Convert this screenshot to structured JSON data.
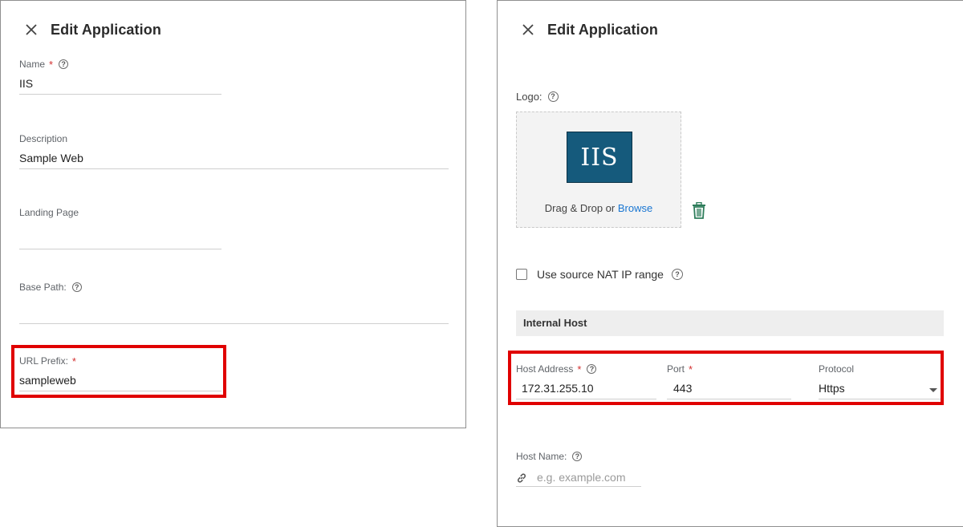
{
  "left": {
    "title": "Edit Application",
    "name": {
      "label": "Name",
      "required": "*",
      "help": "?",
      "value": "IIS"
    },
    "description": {
      "label": "Description",
      "value": "Sample Web"
    },
    "landing_page": {
      "label": "Landing Page",
      "value": ""
    },
    "base_path": {
      "label": "Base Path:",
      "help": "?",
      "value": ""
    },
    "url_prefix": {
      "label": "URL Prefix:",
      "required": "*",
      "value": "sampleweb"
    }
  },
  "right": {
    "title": "Edit Application",
    "logo": {
      "label": "Logo:",
      "help": "?",
      "image_text": "IIS",
      "drop_text": "Drag & Drop or ",
      "browse_label": "Browse"
    },
    "nat": {
      "label": "Use source NAT IP range",
      "help": "?",
      "checked": false
    },
    "section_title": "Internal Host",
    "host_address": {
      "label": "Host Address",
      "required": "*",
      "help": "?",
      "value": "172.31.255.10"
    },
    "port": {
      "label": "Port",
      "required": "*",
      "value": "443"
    },
    "protocol": {
      "label": "Protocol",
      "value": "Https"
    },
    "host_name": {
      "label": "Host Name:",
      "help": "?",
      "placeholder": "e.g. example.com"
    }
  },
  "colors": {
    "highlight": "#e00000",
    "accent": "#1976d2",
    "logo_bg": "#155a7c",
    "trash": "#2e7d5b",
    "required": "#d32f2f"
  },
  "icons": [
    "close-icon",
    "help-icon",
    "trash-icon",
    "link-icon",
    "chevron-down-icon"
  ]
}
